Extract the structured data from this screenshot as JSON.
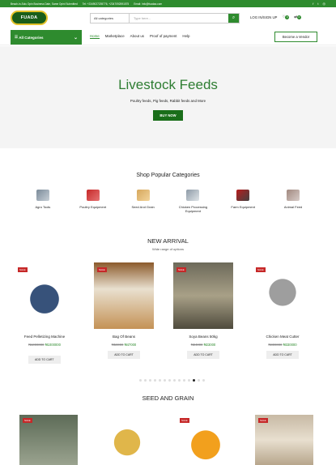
{
  "topbar": {
    "address": "Beach-in-Solu Opin Business Date, Same Opinl Submitted",
    "phone": "Tel: +2349027239776, +2347092591575",
    "email": "Email: Info@fuadaa.com"
  },
  "header": {
    "logo_text": "FUADA",
    "search_category": "All categories",
    "search_placeholder": "Type here...",
    "login_label": "LOG IN/SIGN UP",
    "wishlist_count": "0",
    "compare_count": "0"
  },
  "nav": {
    "all_categories": "All Categories",
    "links": [
      "Home",
      "Marketplace",
      "About us",
      "Proof of payment",
      "Help"
    ],
    "vendor_button": "Become a Vendor"
  },
  "hero": {
    "title": "Livestock Feeds",
    "subtitle": "Poultry feeds, Pig feeds, Rabbit feeds and More",
    "button": "BUY NOW"
  },
  "categories": {
    "title": "Shop Popular Categories",
    "items": [
      "Agro Tools",
      "Poultry Equipment",
      "Seed And Grain",
      "Chicken Processing Equipment",
      "Farm Equipment",
      "Animal Feed"
    ]
  },
  "new_arrival": {
    "title": "NEW ARRIVAL",
    "subtitle": "Wide range of options",
    "products": [
      {
        "name": "Feed Pelletizing Machine",
        "old": "₦1000000",
        "new": "₦1000000",
        "sale": "SALE",
        "cart": "ADD TO CART"
      },
      {
        "name": "Bag Of Beans",
        "old": "₦50000",
        "new": "₦47000",
        "sale": "SALE",
        "cart": "ADD TO CART"
      },
      {
        "name": "Soya Beans 50kg",
        "old": "₦24000",
        "new": "₦23000",
        "sale": "SALE",
        "cart": "ADD TO CART"
      },
      {
        "name": "Chicken Meat Cutter",
        "old": "₦300000",
        "new": "₦330000",
        "sale": "SALE",
        "cart": "ADD TO CART"
      }
    ]
  },
  "seed_grain": {
    "title": "SEED AND GRAIN",
    "sale": "SALE"
  }
}
